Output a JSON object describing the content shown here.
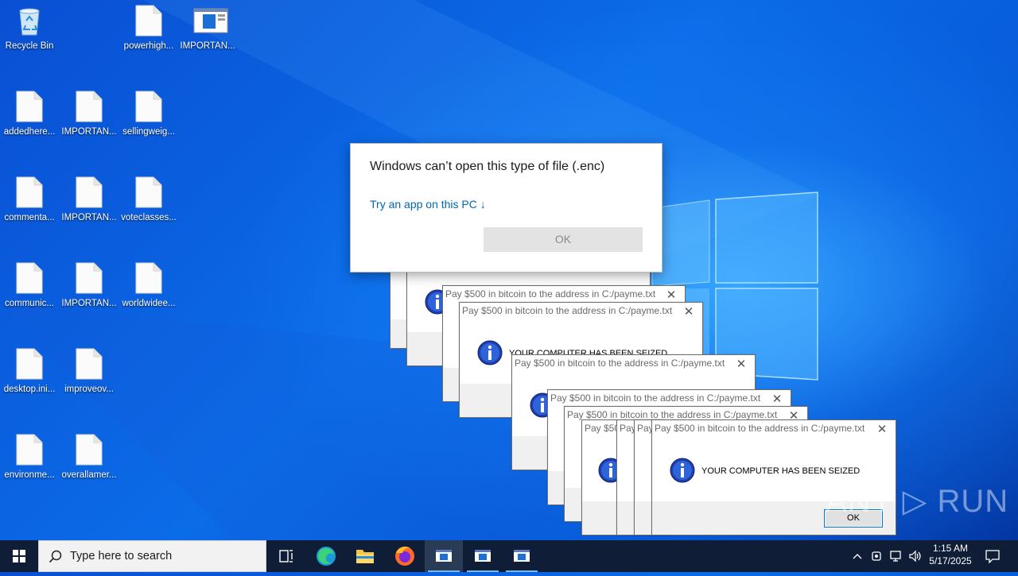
{
  "desktop": {
    "icons": [
      {
        "label": "Recycle Bin",
        "icon": "recycle-bin-icon"
      },
      {
        "label": "powerhigh...",
        "icon": "file-icon"
      },
      {
        "label": "IMPORTAN...",
        "icon": "window-app-icon"
      },
      {
        "label": "addedhere...",
        "icon": "file-icon"
      },
      {
        "label": "IMPORTAN...",
        "icon": "file-icon"
      },
      {
        "label": "sellingweig...",
        "icon": "file-icon"
      },
      {
        "label": "commenta...",
        "icon": "file-icon"
      },
      {
        "label": "IMPORTAN...",
        "icon": "file-icon"
      },
      {
        "label": "voteclasses...",
        "icon": "file-icon"
      },
      {
        "label": "communic...",
        "icon": "file-icon"
      },
      {
        "label": "IMPORTAN...",
        "icon": "file-icon"
      },
      {
        "label": "worldwidee...",
        "icon": "file-icon"
      },
      {
        "label": "desktop.ini...",
        "icon": "file-icon"
      },
      {
        "label": "improveov...",
        "icon": "file-icon"
      },
      {
        "label": "environme...",
        "icon": "file-icon"
      },
      {
        "label": "overallamer...",
        "icon": "file-icon"
      }
    ]
  },
  "ransom_box": {
    "title": "Pay $500 in bitcoin to the address in C:/payme.txt",
    "message": "YOUR COMPUTER HAS BEEN SEIZED",
    "ok_label": "OK",
    "close_glyph": "✕",
    "clipped_title_1": "Pay $50",
    "clipped_title_2": "Pay"
  },
  "open_dialog": {
    "title": "Windows can’t open this type of file (.enc)",
    "link": "Try an app on this PC ↓",
    "ok_label": "OK"
  },
  "taskbar": {
    "search_placeholder": "Type here to search",
    "time": "1:15 AM",
    "date": "5/17/2025",
    "accent_color": "#76b9ed"
  },
  "watermark": "ANY ▷ RUN"
}
